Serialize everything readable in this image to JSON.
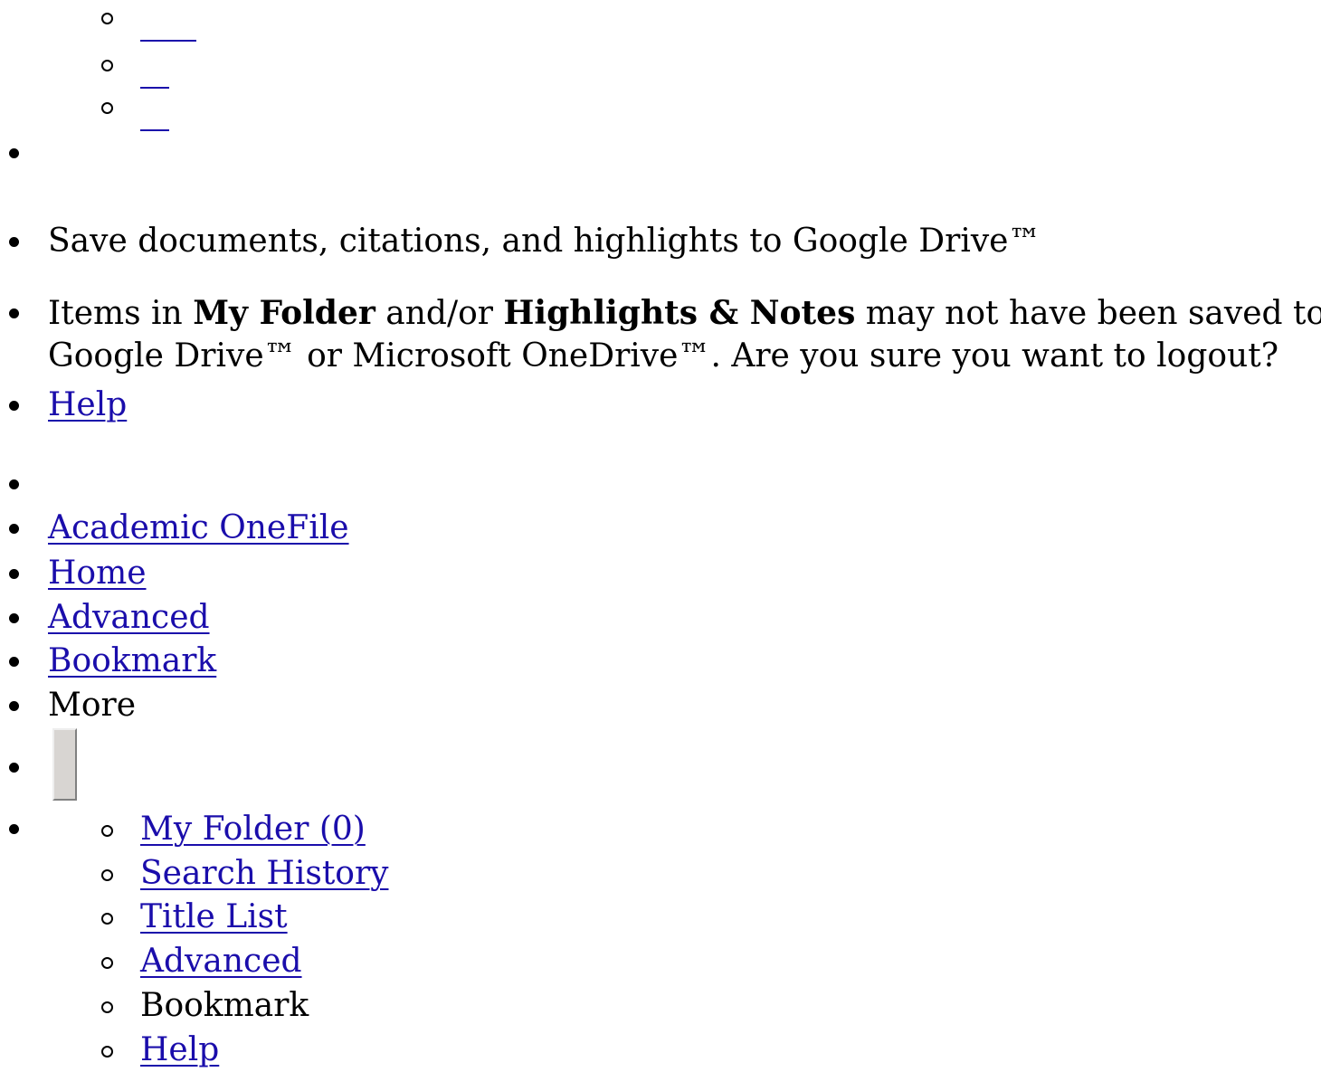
{
  "top_sublist": [
    {
      "label": ""
    },
    {
      "label": ""
    },
    {
      "label": ""
    }
  ],
  "drive_save": {
    "text": "Save documents, citations, and highlights to Google Drive™"
  },
  "logout_warning": {
    "part1": "Items in ",
    "my_folder": "My Folder",
    "part2": " and/or ",
    "highlights_notes": "Highlights & Notes",
    "part3": " may not have been saved to",
    "line2": "Google Drive™ or Microsoft OneDrive™. Are you sure you want to logout?"
  },
  "help_link": "Help",
  "nav": {
    "academic_onefile": "Academic OneFile",
    "home": "Home",
    "advanced": "Advanced",
    "bookmark": "Bookmark",
    "more": "More"
  },
  "more_menu": [
    {
      "label": "My Folder (0)",
      "link": true
    },
    {
      "label": "Search History",
      "link": true
    },
    {
      "label": "Title List",
      "link": true
    },
    {
      "label": "Advanced",
      "link": true
    },
    {
      "label": "Bookmark",
      "link": false
    },
    {
      "label": "Help",
      "link": true
    }
  ],
  "colors": {
    "link": "#1a0dab",
    "text": "#000000",
    "button_face": "#d8d5d2"
  }
}
